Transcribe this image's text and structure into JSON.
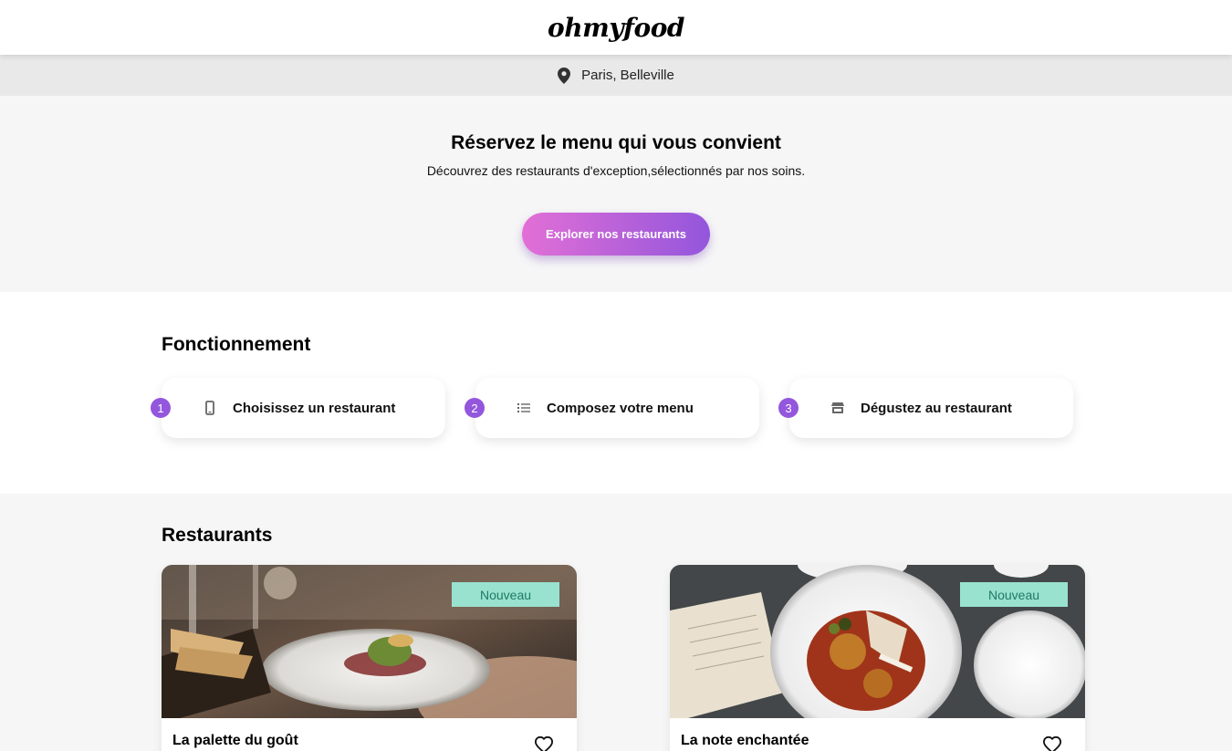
{
  "header": {
    "logo": "ohmyfood"
  },
  "location": {
    "text": "Paris, Belleville",
    "icon": "map-pin-icon"
  },
  "hero": {
    "title": "Réservez le menu qui vous convient",
    "subtitle": "Découvrez des restaurants d'exception,sélectionnés par nos soins.",
    "cta_label": "Explorer nos restaurants",
    "cta_gradient": [
      "#e26fd6",
      "#9356dc"
    ]
  },
  "how_it_works": {
    "title": "Fonctionnement",
    "steps": [
      {
        "number": "1",
        "icon": "phone-icon",
        "label": "Choisissez un restaurant"
      },
      {
        "number": "2",
        "icon": "list-icon",
        "label": "Composez votre menu"
      },
      {
        "number": "3",
        "icon": "store-icon",
        "label": "Dégustez au restaurant"
      }
    ],
    "accent_color": "#9356dc"
  },
  "restaurants": {
    "title": "Restaurants",
    "cards": [
      {
        "badge": "Nouveau",
        "name": "La palette du goût",
        "icon": "heart-icon"
      },
      {
        "badge": "Nouveau",
        "name": "La note enchantée",
        "icon": "heart-icon"
      }
    ],
    "badge_color": "#99e2d0"
  }
}
